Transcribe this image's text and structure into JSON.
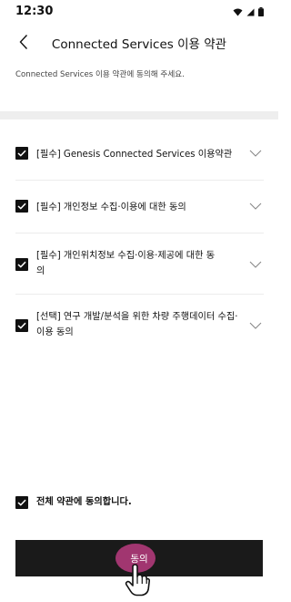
{
  "status_bar": {
    "time": "12:30",
    "icons": [
      "wifi-icon",
      "signal-icon",
      "battery-icon"
    ]
  },
  "header": {
    "title": "Connected Services 이용 약관",
    "back_icon": "chevron-left-icon"
  },
  "subtitle": "Connected Services 이용 약관에 동의해 주세요.",
  "terms": [
    {
      "label": "[필수] Genesis Connected Services 이용약관",
      "checked": true
    },
    {
      "label": "[필수] 개인정보 수집·이용에 대한 동의",
      "checked": true
    },
    {
      "label": "[필수] 개인위치정보 수집·이용·제공에 대한 동의",
      "checked": true
    },
    {
      "label": "[선택] 연구 개발/분석을 위한 차량 주행데이터 수집·이용 동의",
      "checked": true
    }
  ],
  "agree_all": {
    "label": "전체 약관에 동의합니다.",
    "checked": true
  },
  "agree_button": {
    "label": "동의"
  },
  "colors": {
    "button_bg": "#1a1a1a",
    "tap_highlight": "#b03a7a",
    "checkbox": "#111111"
  }
}
